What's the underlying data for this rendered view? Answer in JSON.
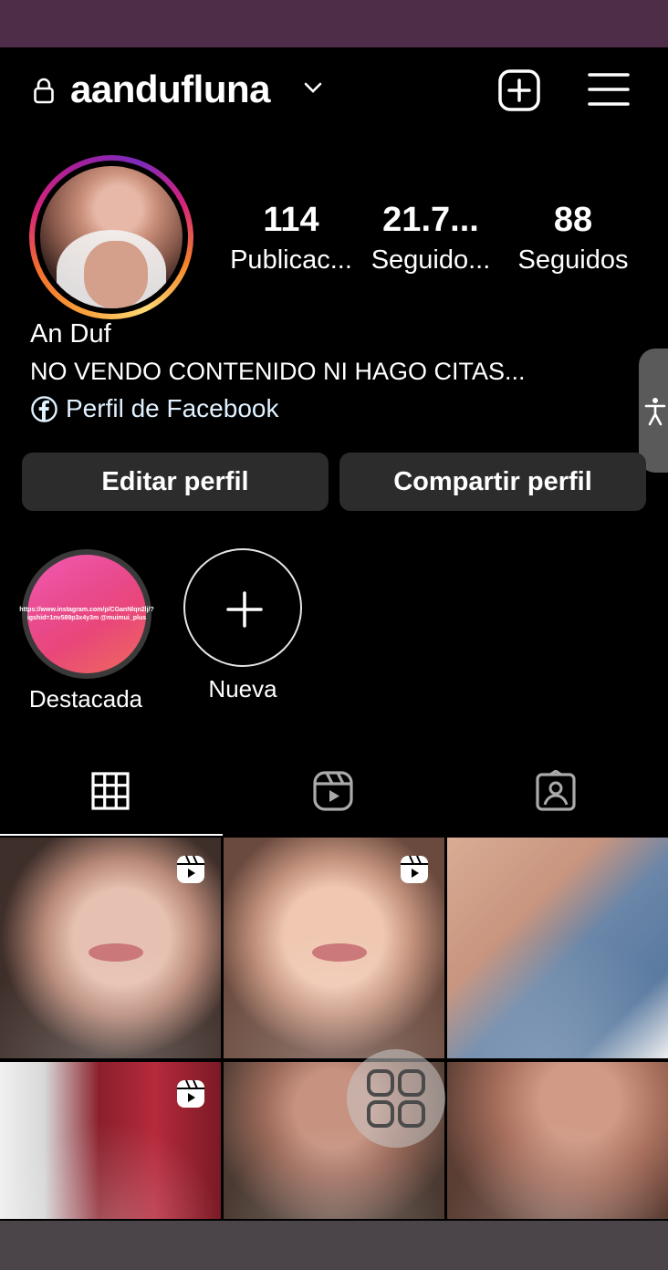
{
  "header": {
    "username": "aandufluna",
    "icons": {
      "lock": "lock-icon",
      "chevron": "chevron-down-icon",
      "add": "add-post-icon",
      "menu": "menu-icon"
    }
  },
  "profile": {
    "stats": [
      {
        "value": "114",
        "label": "Publicac..."
      },
      {
        "value": "21.7...",
        "label": "Seguido..."
      },
      {
        "value": "88",
        "label": "Seguidos"
      }
    ],
    "name": "An Duf",
    "bio": "NO VENDO CONTENIDO NI HAGO CITAS...",
    "facebook_link": "Perfil de Facebook"
  },
  "buttons": {
    "edit": "Editar perfil",
    "share": "Compartir perfil"
  },
  "highlights": [
    {
      "label": "Destacada",
      "cover_text": "https://www.instagram.com/p/CGanNlqn2lj/?igshid=1nv589p3x4y3m @muimui_plus"
    },
    {
      "label": "Nueva"
    }
  ],
  "tabs": [
    "grid-icon",
    "reels-icon",
    "tagged-icon"
  ],
  "posts": [
    {
      "type": "reel"
    },
    {
      "type": "reel"
    },
    {
      "type": "photo"
    },
    {
      "type": "reel"
    },
    {
      "type": "photo"
    },
    {
      "type": "photo"
    }
  ],
  "colors": {
    "status_bar": "#4e2d48",
    "nav_bar": "#4b4449",
    "button_bg": "#2c2c2c",
    "link": "#e0f1ff"
  }
}
